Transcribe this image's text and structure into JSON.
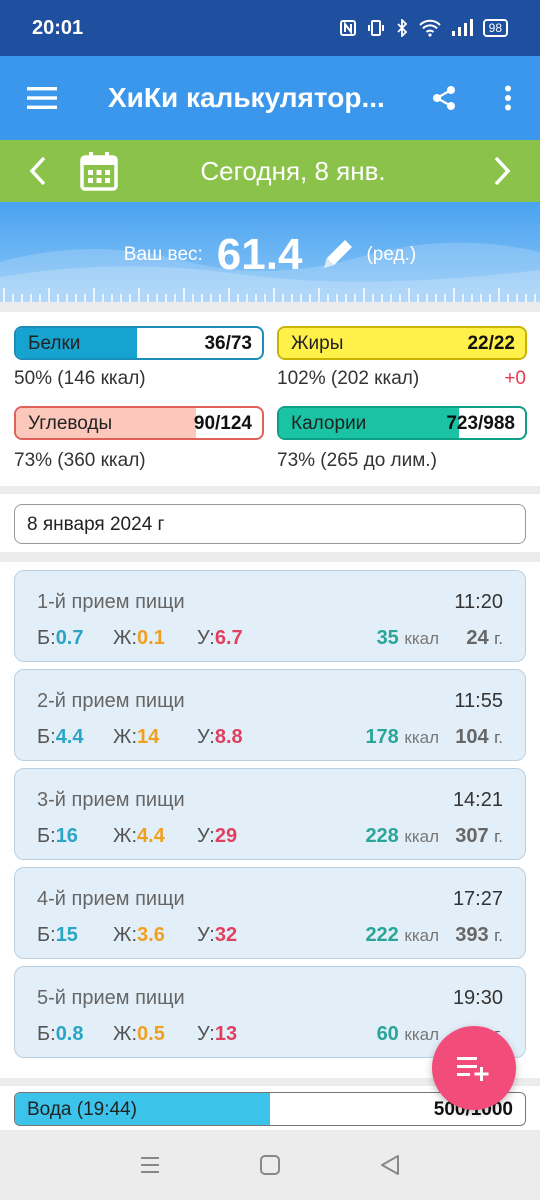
{
  "status_bar": {
    "time": "20:01",
    "battery": "98",
    "icons": [
      "nfc-icon",
      "vibrate-icon",
      "bluetooth-icon",
      "wifi-icon",
      "signal-icon",
      "battery-icon"
    ]
  },
  "app_bar": {
    "title": "ХиКи калькулятор...",
    "icons": [
      "menu-icon",
      "share-icon",
      "more-icon"
    ]
  },
  "date_bar": {
    "label": "Сегодня, 8 янв."
  },
  "weight": {
    "label": "Ваш вес:",
    "value": "61.4",
    "edit_label": "(ред.)"
  },
  "macros": {
    "protein": {
      "name": "Белки",
      "value": "36/73",
      "fill": 0.49,
      "sub": "50% (146 ккал)",
      "color": "#17a3cf"
    },
    "fat": {
      "name": "Жиры",
      "value": "22/22",
      "fill": 1.0,
      "sub": "102% (202 ккал)",
      "extra": "+0",
      "color": "#fff04a"
    },
    "carbs": {
      "name": "Углеводы",
      "value": "90/124",
      "fill": 0.73,
      "sub": "73% (360 ккал)",
      "color": "#fbc8bb"
    },
    "calories": {
      "name": "Калории",
      "value": "723/988",
      "fill": 0.73,
      "sub": "73% (265 до лим.)",
      "color": "#19c3a3"
    }
  },
  "date_field": {
    "value": "8 января 2024 г"
  },
  "meal_labels": {
    "protein": "Б:",
    "fat": "Ж:",
    "carbs": "У:",
    "kcal_unit": "ккал",
    "gram_unit": "г."
  },
  "meals": [
    {
      "name": "1-й прием пищи",
      "time": "11:20",
      "protein": "0.7",
      "fat": "0.1",
      "carbs": "6.7",
      "kcal": "35",
      "grams": "24"
    },
    {
      "name": "2-й прием пищи",
      "time": "11:55",
      "protein": "4.4",
      "fat": "14",
      "carbs": "8.8",
      "kcal": "178",
      "grams": "104"
    },
    {
      "name": "3-й прием пищи",
      "time": "14:21",
      "protein": "16",
      "fat": "4.4",
      "carbs": "29",
      "kcal": "228",
      "grams": "307"
    },
    {
      "name": "4-й прием пищи",
      "time": "17:27",
      "protein": "15",
      "fat": "3.6",
      "carbs": "32",
      "kcal": "222",
      "grams": "393"
    },
    {
      "name": "5-й прием пищи",
      "time": "19:30",
      "protein": "0.8",
      "fat": "0.5",
      "carbs": "13",
      "kcal": "60",
      "grams": "…"
    }
  ],
  "water": {
    "name": "Вода (19:44)",
    "value": "500/1000",
    "fill": 0.5
  },
  "fab": {
    "icon": "add-to-list-icon"
  },
  "nav_bar": {
    "icons": [
      "recent-apps-icon",
      "home-icon",
      "back-icon"
    ]
  }
}
